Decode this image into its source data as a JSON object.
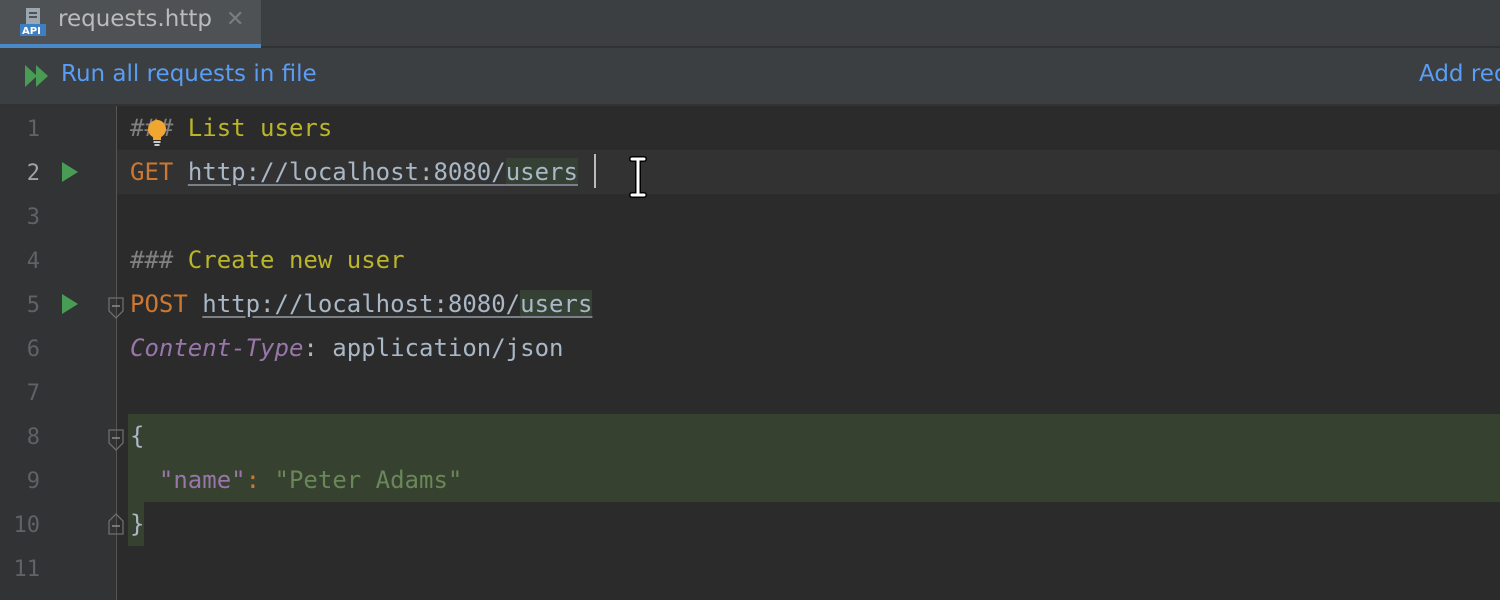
{
  "tab": {
    "label": "requests.http",
    "close": "✕",
    "icon": "api-file-icon"
  },
  "toolbar": {
    "run_all_label": "Run all requests in file",
    "add_label": "Add req"
  },
  "editor": {
    "line_numbers": [
      "1",
      "2",
      "3",
      "4",
      "5",
      "6",
      "7",
      "8",
      "9",
      "10",
      "11"
    ],
    "current_line": 2,
    "lines": {
      "l1": {
        "hash": "###",
        "title": " List users"
      },
      "l2": {
        "method": "GET",
        "url_base": "http://localhost:8080/",
        "url_seg": "users"
      },
      "l4": {
        "hash": "###",
        "title": " Create new user"
      },
      "l5": {
        "method": "POST",
        "url_base": "http://localhost:8080/",
        "url_seg": "users"
      },
      "l6": {
        "header_name": "Content-Type",
        "colon": ":",
        "header_value": " application/json"
      },
      "l8": {
        "brace": "{"
      },
      "l9": {
        "key": "\"name\"",
        "colon": ":",
        "value": "\"Peter Adams\""
      },
      "l10": {
        "brace": "}"
      }
    }
  },
  "colors": {
    "accent": "#589df6",
    "run_green": "#499c54",
    "bulb": "#f0a732"
  }
}
